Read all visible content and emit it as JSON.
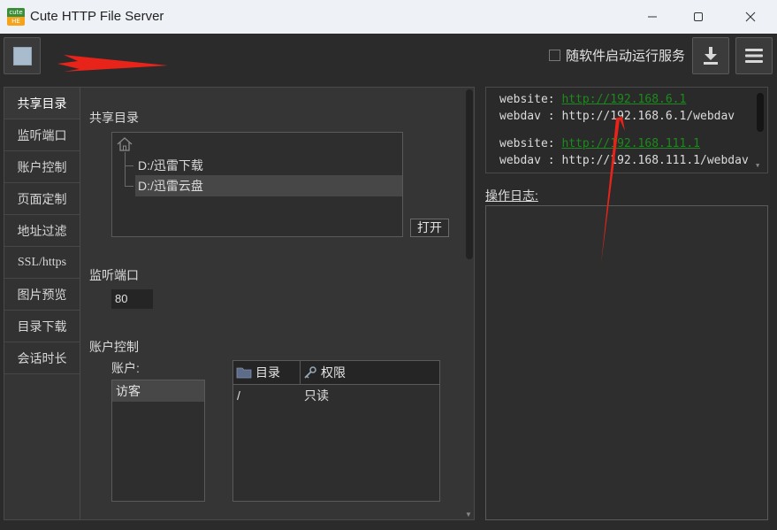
{
  "window": {
    "icon_top": "cute",
    "icon_bottom": "HE",
    "title": "Cute HTTP File Server"
  },
  "toolbar": {
    "autostart_label": "随软件启动运行服务",
    "autostart_checked": false
  },
  "tabs": [
    {
      "label": "共享目录",
      "active": true
    },
    {
      "label": "监听端口"
    },
    {
      "label": "账户控制"
    },
    {
      "label": "页面定制"
    },
    {
      "label": "地址过滤"
    },
    {
      "label": "SSL/https"
    },
    {
      "label": "图片预览"
    },
    {
      "label": "目录下载"
    },
    {
      "label": "会话时长"
    }
  ],
  "share": {
    "section_label": "共享目录",
    "dirs": [
      "D:/迅雷下载",
      "D:/迅雷云盘"
    ],
    "selected_index": 1,
    "open_button": "打开"
  },
  "port": {
    "section_label": "监听端口",
    "value": "80"
  },
  "account": {
    "section_label": "账户控制",
    "list_label": "账户:",
    "accounts": [
      "访客"
    ],
    "perm_headers": [
      "目录",
      "权限"
    ],
    "perm_rows": [
      {
        "dir": "/",
        "perm": "只读"
      }
    ]
  },
  "urls": [
    {
      "prefix": "website: ",
      "link": "http://192.168.6.1",
      "linked": true
    },
    {
      "prefix": "webdav : ",
      "link": "http://192.168.6.1/webdav",
      "linked": false
    },
    {
      "prefix": "website: ",
      "link": "http://192.168.111.1",
      "linked": true
    },
    {
      "prefix": "webdav : ",
      "link": "http://192.168.111.1/webdav",
      "linked": false
    }
  ],
  "log": {
    "label": "操作日志:"
  },
  "colors": {
    "annotation_arrow": "#e8231a",
    "link": "#1d8a1d",
    "background": "#2b2b2b"
  }
}
